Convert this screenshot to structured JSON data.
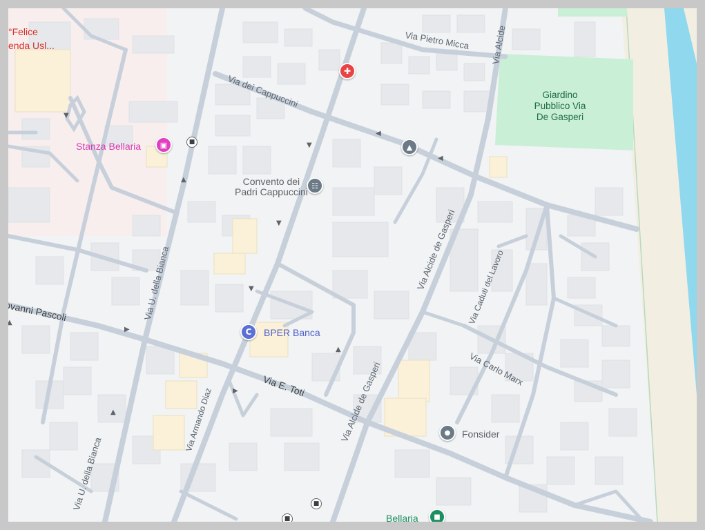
{
  "map": {
    "pois": {
      "stanza_bellaria": "Stanza Bellaria",
      "convento_line1": "Convento dei",
      "convento_line2": "Padri Cappuccini",
      "bper_banca": "BPER Banca",
      "fonsider": "Fonsider",
      "bellaria": "Bellaria",
      "felice_partial": "°Felice",
      "azienda_partial": "enda Usl..."
    },
    "park": {
      "line1": "Giardino",
      "line2": "Pubblico Via",
      "line3": "De Gasperi"
    },
    "streets": {
      "pietro_micca": "Via Pietro Micca",
      "alcide_top": "Via Alcide",
      "dei_cappuccini": "Via dei Cappuccini",
      "alcide_de_gasperi_1": "Via Alcide de Gasperi",
      "alcide_de_gasperi_2": "Via Alcide de Gasperi",
      "caduti_del_lavoro": "Via Caduti del Lavoro",
      "carlo_marx": "Via Carlo Marx",
      "u_della_bianca_1": "Via U. della Bianca",
      "u_della_bianca_2": "Via U. della Bianca",
      "giovanni_pascoli": "iovanni Pascoli",
      "e_toti": "Via E. Toti",
      "armando_diaz": "Via Armando Diaz"
    },
    "colors": {
      "background": "#f1f3f4",
      "road": "#c7d0da",
      "building": "#e8eaed",
      "park": "#c9efd7",
      "water": "#8fd8ee",
      "beach": "#f1ede1",
      "hotel_pin": "#e040c0",
      "hospital_pin": "#e94445",
      "bank_pin": "#5b6fd6",
      "museum_pin": "#6b7a86",
      "generic_pin": "#6b7a86",
      "train_pin": "#1b8f5f"
    },
    "icons": [
      "hospital-icon",
      "hotel-icon",
      "bus-stop-icon",
      "school-icon",
      "museum-icon",
      "bank-icon",
      "location-pin-icon",
      "train-station-icon"
    ]
  }
}
